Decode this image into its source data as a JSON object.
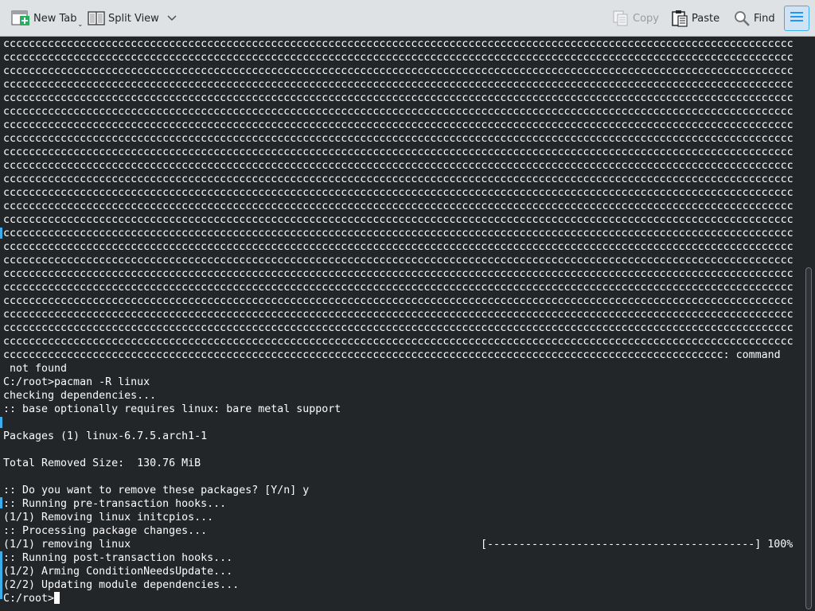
{
  "toolbar": {
    "new_tab": "New Tab",
    "split_view": "Split View",
    "copy": "Copy",
    "paste": "Paste",
    "find": "Find"
  },
  "colors": {
    "terminal_bg": "#232629",
    "terminal_fg": "#fcfcfc",
    "accent": "#3daee9",
    "toolbar_bg": "#dfe2e5"
  },
  "terminal": {
    "c_line": "cccccccccccccccccccccccccccccccccccccccccccccccccccccccccccccccccccccccccccccccccccccccccccccccccccccccccccccccccccccccccccccccccccccccccccccccc",
    "c_line_count": 23,
    "lines": [
      "ccccccccccccccccccccccccccccccccccccccccccccccccccccccccccccccccccccccccccccccccccccccccccccccccccccccccccccccccc: command",
      " not found",
      "C:/root>pacman -R linux",
      "checking dependencies...",
      ":: base optionally requires linux: bare metal support",
      "",
      "Packages (1) linux-6.7.5.arch1-1",
      "",
      "Total Removed Size:  130.76 MiB",
      "",
      ":: Do you want to remove these packages? [Y/n] y",
      ":: Running pre-transaction hooks...",
      "(1/1) Removing linux initcpios...",
      ":: Processing package changes...",
      "(1/1) removing linux",
      ":: Running post-transaction hooks...",
      "(1/2) Arming ConditionNeedsUpdate...",
      "(2/2) Updating module dependencies...",
      "C:/root>"
    ],
    "progress_bar": "[------------------------------------------] 100%",
    "progress_percent": 100
  }
}
